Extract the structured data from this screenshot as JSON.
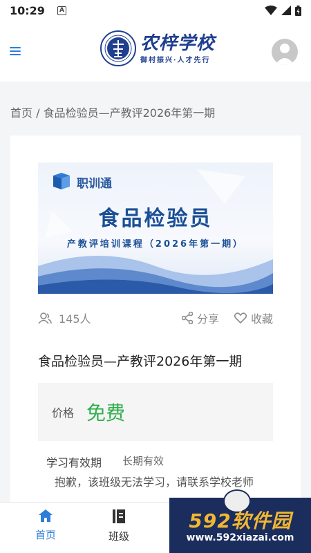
{
  "status_bar": {
    "time": "10:29",
    "notification_letter": "A"
  },
  "header": {
    "logo_title": "农梓学校",
    "logo_subtitle": "御村振兴·人才先行",
    "menu_icon": "hamburger-menu-icon",
    "avatar_icon": "default-avatar-icon",
    "accent_color": "#2d7ddb"
  },
  "breadcrumb": {
    "home": "首页",
    "separator": " / ",
    "current": "食品检验员—产教评2026年第一期"
  },
  "course": {
    "banner": {
      "brand": "职训通",
      "title": "食品检验员",
      "subtitle": "产教评培训课程（2026年第一期）"
    },
    "people_count": "145人",
    "share_label": "分享",
    "favorite_label": "收藏",
    "title": "食品检验员—产教评2026年第一期",
    "price_label": "价格",
    "price_value": "免费",
    "price_color": "#2fae4d",
    "validity_label": "学习有效期",
    "validity_value": "长期有效",
    "notice": "抱歉，该班级无法学习，请联系学校老师"
  },
  "bottom_nav": {
    "items": [
      {
        "label": "首页",
        "icon": "home-icon",
        "active": true
      },
      {
        "label": "班级",
        "icon": "class-book-icon",
        "active": false
      }
    ]
  },
  "watermark": {
    "title": "592软件园",
    "url": "www.592xiazai.com"
  }
}
